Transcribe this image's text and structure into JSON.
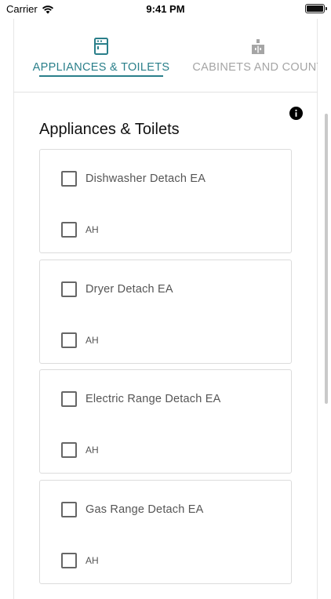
{
  "status_bar": {
    "carrier": "Carrier",
    "time": "9:41 PM"
  },
  "tabs": [
    {
      "label": "APPLIANCES & TOILETS",
      "icon": "appliance-icon",
      "active": true
    },
    {
      "label": "CABINETS AND COUNT",
      "icon": "cabinet-faucet-icon",
      "active": false
    }
  ],
  "section": {
    "title": "Appliances & Toilets"
  },
  "items": [
    {
      "label": "Dishwasher Detach EA",
      "sub_label": "AH"
    },
    {
      "label": "Dryer Detach EA",
      "sub_label": "AH"
    },
    {
      "label": "Electric Range Detach EA",
      "sub_label": "AH"
    },
    {
      "label": "Gas Range Detach EA",
      "sub_label": "AH"
    }
  ],
  "colors": {
    "accent": "#2a7f8a",
    "inactive": "#a5a5a5"
  }
}
